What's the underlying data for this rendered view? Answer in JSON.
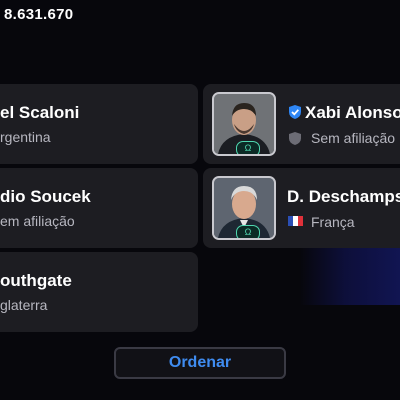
{
  "header": {
    "coins": "8.631.670"
  },
  "managers": [
    {
      "name": "el Scaloni",
      "subtitle": "rgentina"
    },
    {
      "name": "Xabi Alonso",
      "subtitle": "Sem afiliação",
      "verified": true
    },
    {
      "name": "dio Soucek",
      "subtitle": "em afiliação"
    },
    {
      "name": "D. Deschamps",
      "subtitle": "França"
    },
    {
      "name": "outhgate",
      "subtitle": "glaterra"
    }
  ],
  "badge_label": "Ω",
  "sort_button": {
    "label": "Ordenar"
  },
  "colors": {
    "accent": "#3f8cf0",
    "verified": "#2e86f5",
    "badge": "#4fd7b0"
  }
}
